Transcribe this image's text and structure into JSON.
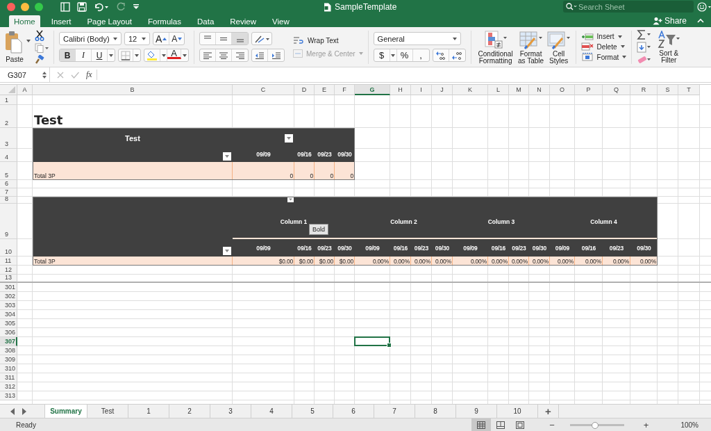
{
  "window": {
    "title": "SampleTemplate",
    "search_placeholder": "Search Sheet"
  },
  "ribbon_tabs": [
    {
      "label": "Home",
      "selected": true
    },
    {
      "label": "Insert",
      "selected": false
    },
    {
      "label": "Page Layout",
      "selected": false
    },
    {
      "label": "Formulas",
      "selected": false
    },
    {
      "label": "Data",
      "selected": false
    },
    {
      "label": "Review",
      "selected": false
    },
    {
      "label": "View",
      "selected": false
    }
  ],
  "share": "Share",
  "ribbon": {
    "paste": "Paste",
    "font": "Calibri (Body)",
    "font_size": "12",
    "font_grow": "A",
    "font_shrink": "A",
    "bold": "B",
    "italic": "I",
    "underline": "U",
    "font_color": "A",
    "wrap_text": "Wrap Text",
    "merge_center": {
      "label": "Merge & Center",
      "disabled": true
    },
    "number_format": "General",
    "currency": "$",
    "percent": "%",
    "comma": ",",
    "conditional_formatting": "Conditional Formatting",
    "format_as_table": "Format as Table",
    "cell_styles": "Cell Styles",
    "insert": "Insert",
    "delete": "Delete",
    "format": "Format",
    "sort_filter": "Sort & Filter"
  },
  "formula_bar": {
    "name_box": "G307",
    "function_label": "fx"
  },
  "columns": [
    {
      "label": "A",
      "selected": false
    },
    {
      "label": "B",
      "selected": false
    },
    {
      "label": "C",
      "selected": false
    },
    {
      "label": "D",
      "selected": false
    },
    {
      "label": "E",
      "selected": false
    },
    {
      "label": "F",
      "selected": false
    },
    {
      "label": "G",
      "selected": true
    },
    {
      "label": "H",
      "selected": false
    },
    {
      "label": "I",
      "selected": false
    },
    {
      "label": "J",
      "selected": false
    },
    {
      "label": "K",
      "selected": false
    },
    {
      "label": "L",
      "selected": false
    },
    {
      "label": "M",
      "selected": false
    },
    {
      "label": "N",
      "selected": false
    },
    {
      "label": "O",
      "selected": false
    },
    {
      "label": "P",
      "selected": false
    },
    {
      "label": "Q",
      "selected": false
    },
    {
      "label": "R",
      "selected": false
    },
    {
      "label": "S",
      "selected": false
    },
    {
      "label": "T",
      "selected": false
    }
  ],
  "rows": [
    {
      "label": "1",
      "selected": false
    },
    {
      "label": "2",
      "selected": false
    },
    {
      "label": "3",
      "selected": false
    },
    {
      "label": "4",
      "selected": false
    },
    {
      "label": "5",
      "selected": false
    },
    {
      "label": "6",
      "selected": false
    },
    {
      "label": "7",
      "selected": false
    },
    {
      "label": "8",
      "selected": false
    },
    {
      "label": "9",
      "selected": false
    },
    {
      "label": "10",
      "selected": false
    },
    {
      "label": "11",
      "selected": false
    },
    {
      "label": "12",
      "selected": false
    },
    {
      "label": "13",
      "selected": false
    },
    {
      "label": "301",
      "selected": false
    },
    {
      "label": "302",
      "selected": false
    },
    {
      "label": "303",
      "selected": false
    },
    {
      "label": "304",
      "selected": false
    },
    {
      "label": "305",
      "selected": false
    },
    {
      "label": "306",
      "selected": false
    },
    {
      "label": "307",
      "selected": true
    },
    {
      "label": "308",
      "selected": false
    },
    {
      "label": "309",
      "selected": false
    },
    {
      "label": "310",
      "selected": false
    },
    {
      "label": "311",
      "selected": false
    },
    {
      "label": "312",
      "selected": false
    },
    {
      "label": "313",
      "selected": false
    }
  ],
  "sheet_title": "Test",
  "table_1": {
    "title": "Test",
    "dates": [
      "09/09",
      "09/16",
      "09/23",
      "09/30"
    ],
    "total_label": "Total 3P",
    "totals": [
      "0",
      "0",
      "0",
      "0"
    ]
  },
  "table_2": {
    "groups": [
      "Column 1",
      "Column 2",
      "Column 3",
      "Column 4"
    ],
    "dates": [
      "09/09",
      "09/16",
      "09/23",
      "09/30",
      "09/09",
      "09/16",
      "09/23",
      "09/30",
      "09/09",
      "09/16",
      "09/23",
      "09/30",
      "09/09",
      "09/16",
      "09/23",
      "09/30"
    ],
    "total_label": "Total 3P",
    "totals": [
      "$0.00",
      "$0.00",
      "$0.00",
      "$0.00",
      "0.00%",
      "0.00%",
      "0.00%",
      "0.00%",
      "0.00%",
      "0.00%",
      "0.00%",
      "0.00%",
      "0.00%",
      "0.00%",
      "0.00%",
      "0.00%"
    ]
  },
  "tooltip": "Bold",
  "sheet_tabs": [
    {
      "label": "Summary",
      "selected": true
    },
    {
      "label": "Test",
      "selected": false
    },
    {
      "label": "1",
      "selected": false
    },
    {
      "label": "2",
      "selected": false
    },
    {
      "label": "3",
      "selected": false
    },
    {
      "label": "4",
      "selected": false
    },
    {
      "label": "5",
      "selected": false
    },
    {
      "label": "6",
      "selected": false
    },
    {
      "label": "7",
      "selected": false
    },
    {
      "label": "8",
      "selected": false
    },
    {
      "label": "9",
      "selected": false
    },
    {
      "label": "10",
      "selected": false
    }
  ],
  "add_sheet": "+",
  "status_bar": {
    "status": "Ready",
    "views": [
      {
        "kind": "normal",
        "selected": true
      },
      {
        "kind": "page_layout",
        "selected": false
      },
      {
        "kind": "page_break",
        "selected": false
      }
    ],
    "zoom_out": "−",
    "zoom_in": "+",
    "zoom": {
      "level": 0.46
    },
    "zoom_label": "100%"
  }
}
